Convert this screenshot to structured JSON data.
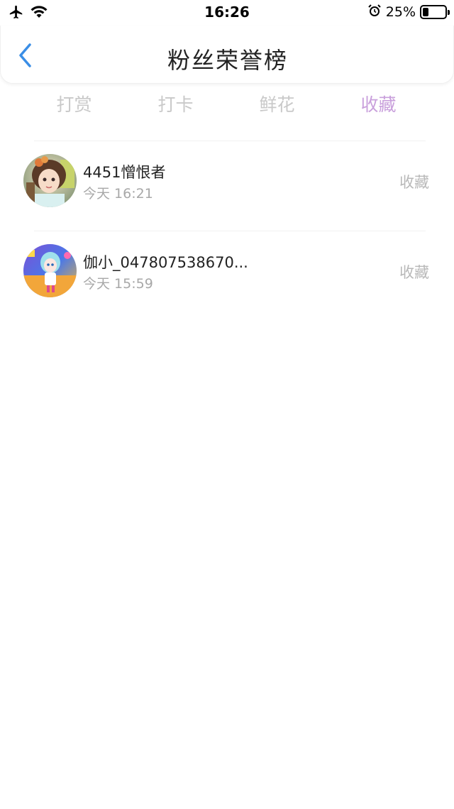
{
  "status_bar": {
    "time": "16:26",
    "battery_text": "25%",
    "battery_level": 0.25,
    "icons": [
      "airplane-icon",
      "wifi-icon",
      "alarm-icon",
      "battery-icon"
    ]
  },
  "header": {
    "title": "粉丝荣誉榜",
    "back_icon": "chevron-left-icon",
    "accent_color": "#3a8ee6"
  },
  "tabs": [
    {
      "label": "打赏",
      "active": false
    },
    {
      "label": "打卡",
      "active": false
    },
    {
      "label": "鲜花",
      "active": false
    },
    {
      "label": "收藏",
      "active": true
    }
  ],
  "active_tab_color": "#c9a0dc",
  "list": [
    {
      "name": "4451憎恨者",
      "time": "今天 16:21",
      "action": "收藏"
    },
    {
      "name": "伽小_047807538670...",
      "time": "今天 15:59",
      "action": "收藏"
    }
  ]
}
